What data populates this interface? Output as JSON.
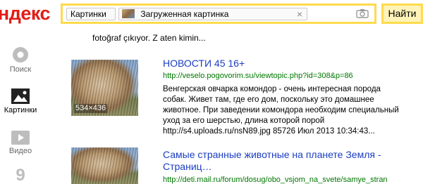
{
  "header": {
    "logo": "Яндекс",
    "search": {
      "kind_chip": "Картинки",
      "image_chip": "Загруженная картинка",
      "close_glyph": "×"
    },
    "find_button": "Найти"
  },
  "sidebar": {
    "items": [
      {
        "label": "Поиск"
      },
      {
        "label": "Картинки"
      },
      {
        "label": "Видео"
      },
      {
        "label": "9"
      }
    ]
  },
  "results": {
    "partial_snippet": "fotoğraf çıkıyor. Z aten kimin...",
    "items": [
      {
        "thumb_size": "534×436",
        "title": "НОВОСТИ 45 16+",
        "url": "http://veselo.pogovorim.su/viewtopic.php?id=308&p=86",
        "description": "Венгерская овчарка комондор - очень интересная порода собак. Живет там, где его дом, поскольку это домашнее животное. При заведении комондора необходим специальный уход за его шерстью, длина которой порой http://s4.uploads.ru/nsN89.jpg 85726 Июл 2013 10:34:43..."
      },
      {
        "title": "Самые странные животные на планете Земля - Страниц…",
        "url": "http://deti.mail.ru/forum/dosug/obo_vsjom_na_svete/samye_stran"
      }
    ]
  },
  "colors": {
    "accent_yellow": "#ffdb4d",
    "logo_red": "#e21c16",
    "link_blue": "#1a3dc1",
    "url_green": "#007700"
  }
}
